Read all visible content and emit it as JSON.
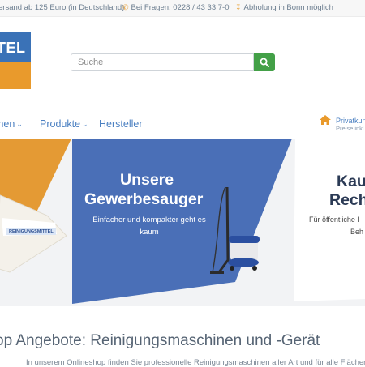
{
  "topbar": {
    "shipping": "ersand ab 125 Euro (in Deutschland)",
    "phone": "Bei Fragen: 0228 / 43 33 7-0",
    "pickup": "Abholung in Bonn möglich"
  },
  "logo": {
    "text": "TEL"
  },
  "search": {
    "placeholder": "Suche"
  },
  "nav": {
    "item1": "men",
    "item2": "Produkte",
    "item3": "Hersteller",
    "privat": "Privatkun",
    "privat_sub": "Preise inkl."
  },
  "banner": {
    "slide1_label": "REINIGUNGSMITTEL",
    "slide2_title_line1": "Unsere",
    "slide2_title_line2": "Gewerbesauger",
    "slide2_sub_line1": "Einfacher und kompakter geht es",
    "slide2_sub_line2": "kaum",
    "slide3_title_line1": "Kau",
    "slide3_title_line2": "Rech",
    "slide3_sub_line1": "Für öffentliche I",
    "slide3_sub_line2": "Beh"
  },
  "main": {
    "headline": "op Angebote: Reinigungsmaschinen und -Gerät",
    "subtext": "In unserem Onlineshop finden Sie professionelle Reinigungsmaschinen aller Art und für alle Flächen"
  },
  "colors": {
    "brand_blue": "#3a72b7",
    "brand_orange": "#e99a2c",
    "search_green": "#43a047",
    "link_blue": "#4a7fc1"
  },
  "icons": {
    "phone": "phone-icon",
    "download": "download-icon",
    "search": "search-icon",
    "home": "home-icon"
  }
}
